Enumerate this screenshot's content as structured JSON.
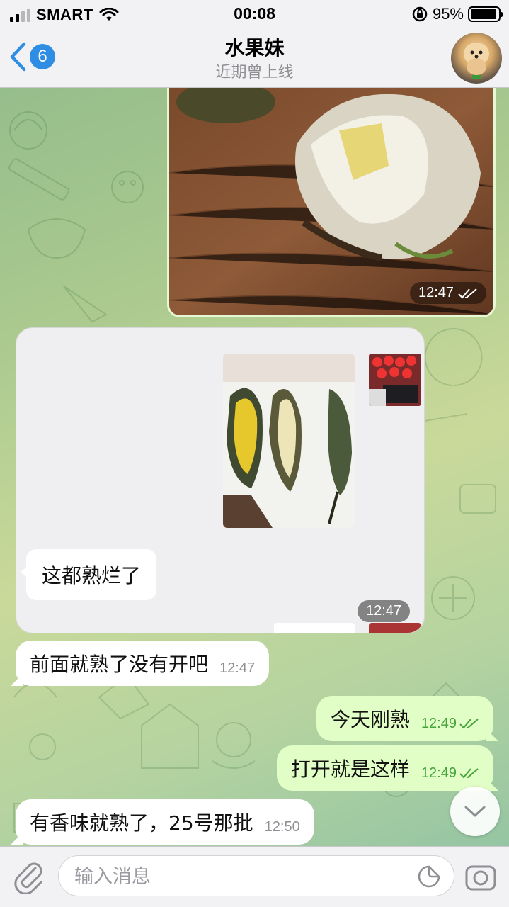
{
  "status_bar": {
    "carrier": "SMART",
    "time": "00:08",
    "battery_percent": "95%",
    "signal_bars": 2,
    "battery_level": 0.95,
    "icons": [
      "signal-icon",
      "wifi-icon",
      "orientation-lock-icon",
      "battery-icon"
    ]
  },
  "header": {
    "back_badge": "6",
    "title": "水果妹",
    "subtitle": "近期曾上线",
    "icons": [
      "chevron-left-icon",
      "avatar"
    ]
  },
  "messages": [
    {
      "type": "photo",
      "direction": "out",
      "content": "durian photo",
      "time": "12:47",
      "status": "read"
    },
    {
      "type": "forwarded_screenshot",
      "direction": "in",
      "time": "12:47",
      "inner_text": "这都熟烂了"
    },
    {
      "type": "text",
      "direction": "in",
      "text": "前面就熟了没有开吧",
      "time": "12:47"
    },
    {
      "type": "text",
      "direction": "out",
      "text": "今天刚熟",
      "time": "12:49",
      "status": "read"
    },
    {
      "type": "text",
      "direction": "out",
      "text": "打开就是这样",
      "time": "12:49",
      "status": "read"
    },
    {
      "type": "text",
      "direction": "in",
      "text": "有香味就熟了，25号那批",
      "time": "12:50"
    }
  ],
  "input_bar": {
    "placeholder": "输入消息",
    "value": "",
    "icons": [
      "paperclip-icon",
      "sticker-icon",
      "camera-icon"
    ]
  },
  "accent_colors": {
    "blue": "#2f8de4",
    "outgoing_bubble": "#e1fec6",
    "outgoing_meta": "#45a33a"
  }
}
